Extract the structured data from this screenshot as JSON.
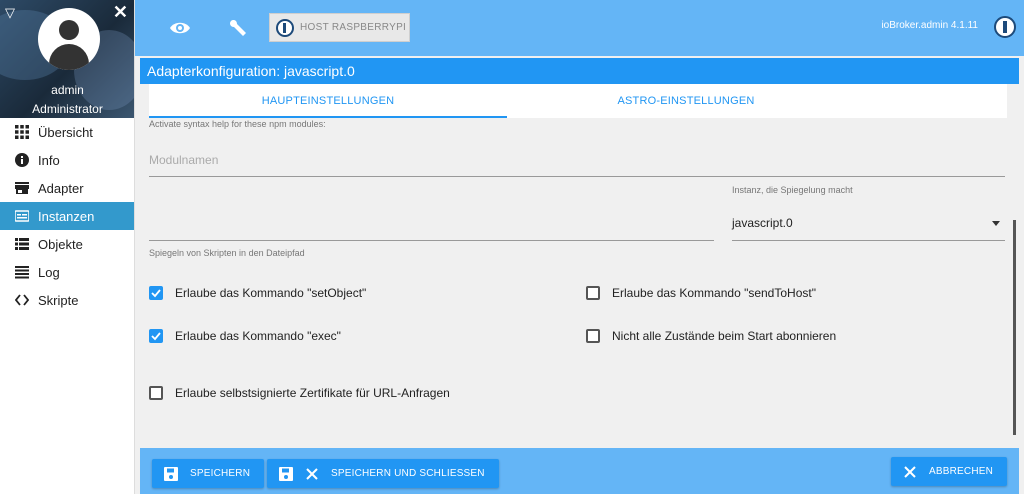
{
  "sidebar": {
    "user": {
      "name": "admin",
      "role": "Administrator"
    },
    "items": [
      {
        "label": "Übersicht",
        "icon": "grid-icon"
      },
      {
        "label": "Info",
        "icon": "info-icon"
      },
      {
        "label": "Adapter",
        "icon": "store-icon"
      },
      {
        "label": "Instanzen",
        "icon": "instances-icon",
        "active": true
      },
      {
        "label": "Objekte",
        "icon": "list-icon"
      },
      {
        "label": "Log",
        "icon": "lines-icon"
      },
      {
        "label": "Skripte",
        "icon": "code-icon"
      }
    ]
  },
  "topbar": {
    "host_button": "HOST RASPBERRYPI",
    "version": "ioBroker.admin 4.1.11"
  },
  "config": {
    "title": "Adapterkonfiguration: javascript.0",
    "tabs": [
      {
        "label": "HAUPTEINSTELLUNGEN",
        "active": true
      },
      {
        "label": "ASTRO-EINSTELLUNGEN",
        "active": false
      }
    ],
    "npm_help_label": "Activate syntax help for these npm modules:",
    "module_placeholder": "Modulnamen",
    "mirror_instance_label": "Instanz, die Spiegelung macht",
    "mirror_instance_value": "javascript.0",
    "mirror_path_label": "Spiegeln von Skripten in den Dateipfad",
    "checkboxes": [
      {
        "label": "Erlaube das Kommando \"setObject\"",
        "checked": true
      },
      {
        "label": "Erlaube das Kommando \"sendToHost\"",
        "checked": false
      },
      {
        "label": "Erlaube das Kommando \"exec\"",
        "checked": true
      },
      {
        "label": "Nicht alle Zustände beim Start abonnieren",
        "checked": false
      },
      {
        "label": "Erlaube selbstsignierte Zertifikate für URL-Anfragen",
        "checked": false
      }
    ]
  },
  "footer": {
    "save": "SPEICHERN",
    "save_close": "SPEICHERN UND SCHLIESSEN",
    "cancel": "ABBRECHEN"
  },
  "colors": {
    "primary": "#2196f3",
    "topbar": "#64b5f6",
    "active_nav": "#3399cc"
  }
}
